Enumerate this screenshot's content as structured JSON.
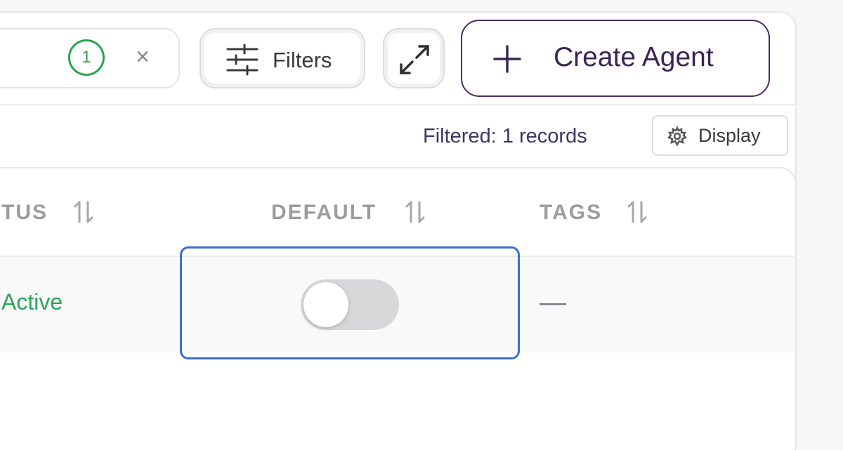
{
  "toolbar": {
    "filter_count": "1",
    "clear_symbol": "×",
    "filters_label": "Filters",
    "create_label": "Create Agent",
    "create_icon": "plus-icon",
    "expand_icon": "expand-icon",
    "filters_icon": "sliders-icon"
  },
  "info": {
    "filtered_text": "Filtered: 1 records",
    "display_label": "Display",
    "display_icon": "gear-icon"
  },
  "table": {
    "columns": [
      {
        "label": "TUS"
      },
      {
        "label": "DEFAULT"
      },
      {
        "label": "TAGS"
      }
    ],
    "rows": [
      {
        "status": "Active",
        "default": false,
        "tags": "—"
      }
    ]
  },
  "colors": {
    "accent": "#4a2a66",
    "status_active": "#2aa35a",
    "focus": "#3b6fd6"
  }
}
